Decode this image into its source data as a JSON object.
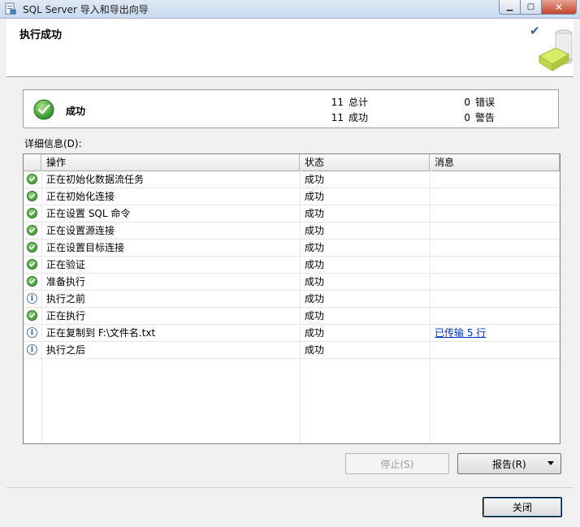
{
  "window": {
    "title": "SQL Server 导入和导出向导"
  },
  "header": {
    "title": "执行成功"
  },
  "summary": {
    "status": "成功",
    "total_count": "11",
    "total_label": "总计",
    "success_count": "11",
    "success_label": "成功",
    "error_count": "0",
    "error_label": "错误",
    "warning_count": "0",
    "warning_label": "警告"
  },
  "details": {
    "label": "详细信息(D):",
    "columns": [
      "操作",
      "状态",
      "消息"
    ],
    "rows": [
      {
        "icon": "success-icon",
        "action": "正在初始化数据流任务",
        "status": "成功",
        "message": ""
      },
      {
        "icon": "success-icon",
        "action": "正在初始化连接",
        "status": "成功",
        "message": ""
      },
      {
        "icon": "success-icon",
        "action": "正在设置 SQL 命令",
        "status": "成功",
        "message": ""
      },
      {
        "icon": "success-icon",
        "action": "正在设置源连接",
        "status": "成功",
        "message": ""
      },
      {
        "icon": "success-icon",
        "action": "正在设置目标连接",
        "status": "成功",
        "message": ""
      },
      {
        "icon": "success-icon",
        "action": "正在验证",
        "status": "成功",
        "message": ""
      },
      {
        "icon": "success-icon",
        "action": "准备执行",
        "status": "成功",
        "message": ""
      },
      {
        "icon": "info-icon",
        "action": "执行之前",
        "status": "成功",
        "message": ""
      },
      {
        "icon": "success-icon",
        "action": "正在执行",
        "status": "成功",
        "message": ""
      },
      {
        "icon": "info-icon",
        "action": "正在复制到 F:\\文件名.txt",
        "status": "成功",
        "message": "已传输 5 行"
      },
      {
        "icon": "info-icon",
        "action": "执行之后",
        "status": "成功",
        "message": ""
      }
    ]
  },
  "buttons": {
    "stop": "停止(S)",
    "report": "报告(R)",
    "close": "关闭"
  },
  "colors": {
    "success": "#2c8d23",
    "info": "#2c5aa0",
    "link": "#0033cc"
  }
}
